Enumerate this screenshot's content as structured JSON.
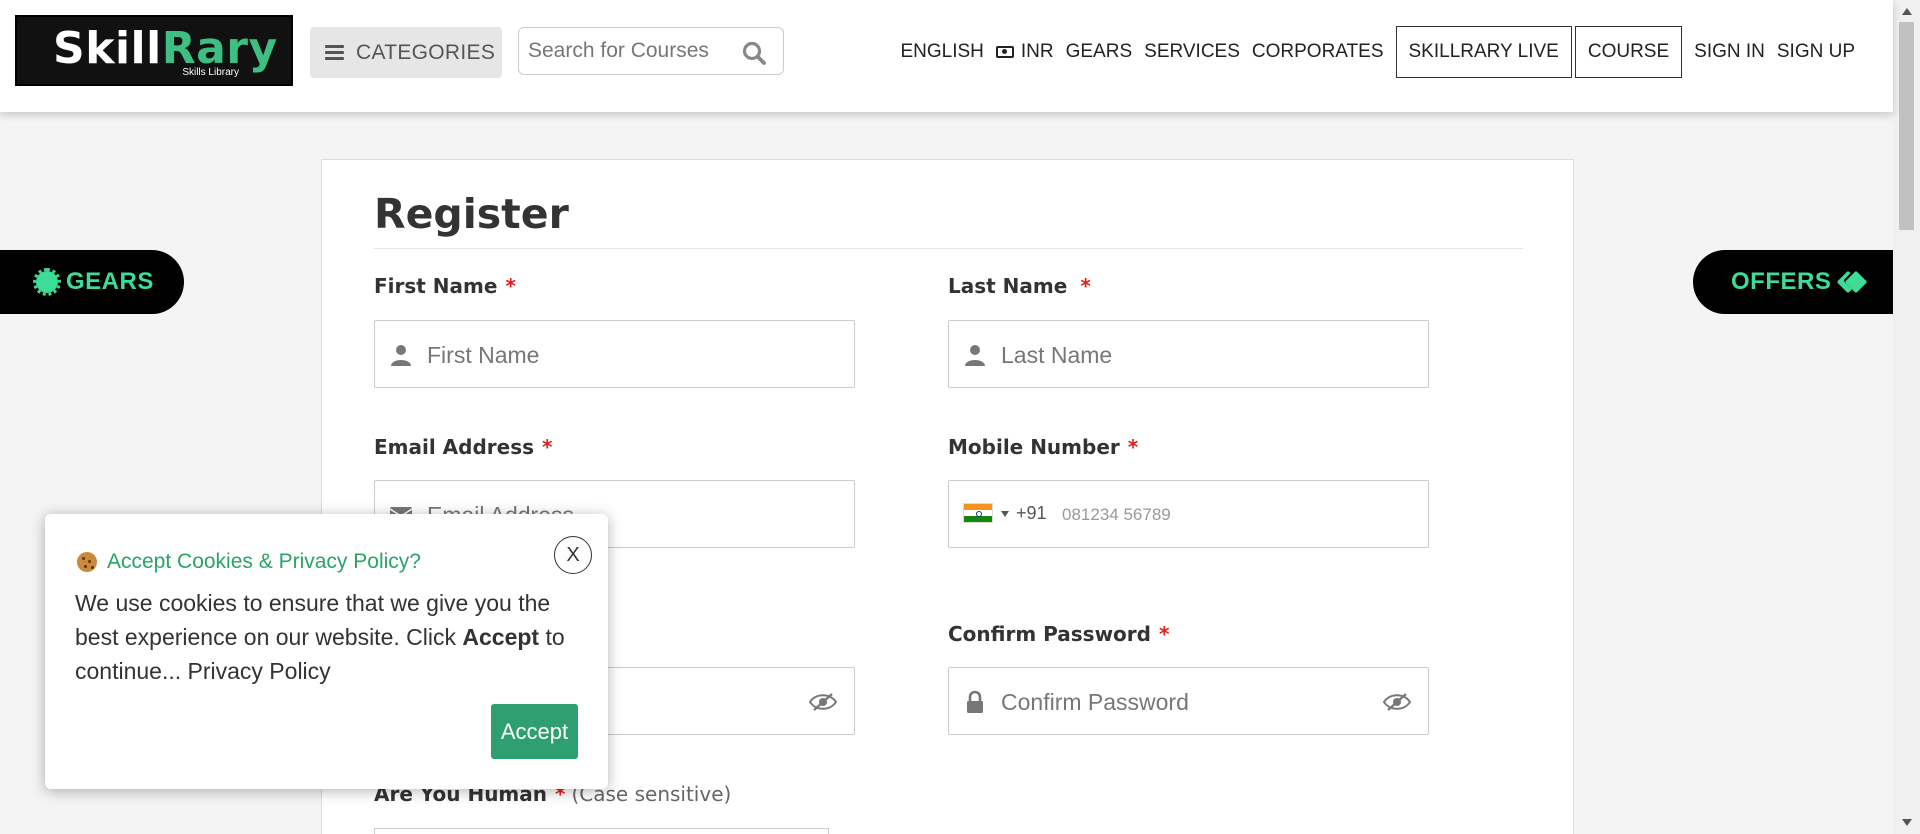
{
  "header": {
    "logo": {
      "brand_a": "Skill",
      "brand_b": "Rary",
      "tagline": "Skills Library"
    },
    "categories_label": "CATEGORIES",
    "search": {
      "placeholder": "Search for Courses",
      "value": ""
    },
    "nav": {
      "language": "ENGLISH",
      "currency": "INR",
      "gears": "GEARS",
      "services": "SERVICES",
      "corporates": "CORPORATES",
      "skillrary_live": "SKILLRARY LIVE",
      "course": "COURSE",
      "sign_in": "SIGN IN",
      "sign_up": "SIGN UP"
    }
  },
  "side_tabs": {
    "gears": "GEARS",
    "offers": "OFFERS"
  },
  "form": {
    "title": "Register",
    "first_name": {
      "label": "First Name",
      "required": "*",
      "placeholder": "First Name"
    },
    "last_name": {
      "label": "Last Name",
      "required": "*",
      "placeholder": "Last Name"
    },
    "email": {
      "label": "Email Address",
      "required": "*",
      "placeholder": "Email Address"
    },
    "mobile": {
      "label": "Mobile Number",
      "required": "*",
      "dial_code": "+91",
      "placeholder": "081234 56789"
    },
    "confirm_password": {
      "label": "Confirm Password",
      "required": "*",
      "placeholder": "Confirm Password"
    },
    "human_check": {
      "label": "Are You Human",
      "required": "*",
      "note": "(Case sensitive)"
    }
  },
  "cookie_popup": {
    "title": "Accept Cookies & Privacy Policy?",
    "close_label": "X",
    "body_part1": "We use cookies to ensure that we give you the best experience on our website. Click ",
    "body_bold": "Accept",
    "body_part2": " to continue... Privacy Policy",
    "accept_label": "Accept"
  },
  "colors": {
    "brand_green": "#3ddc97",
    "accept_green": "#2e9f6e",
    "required_red": "#e31c1c"
  }
}
